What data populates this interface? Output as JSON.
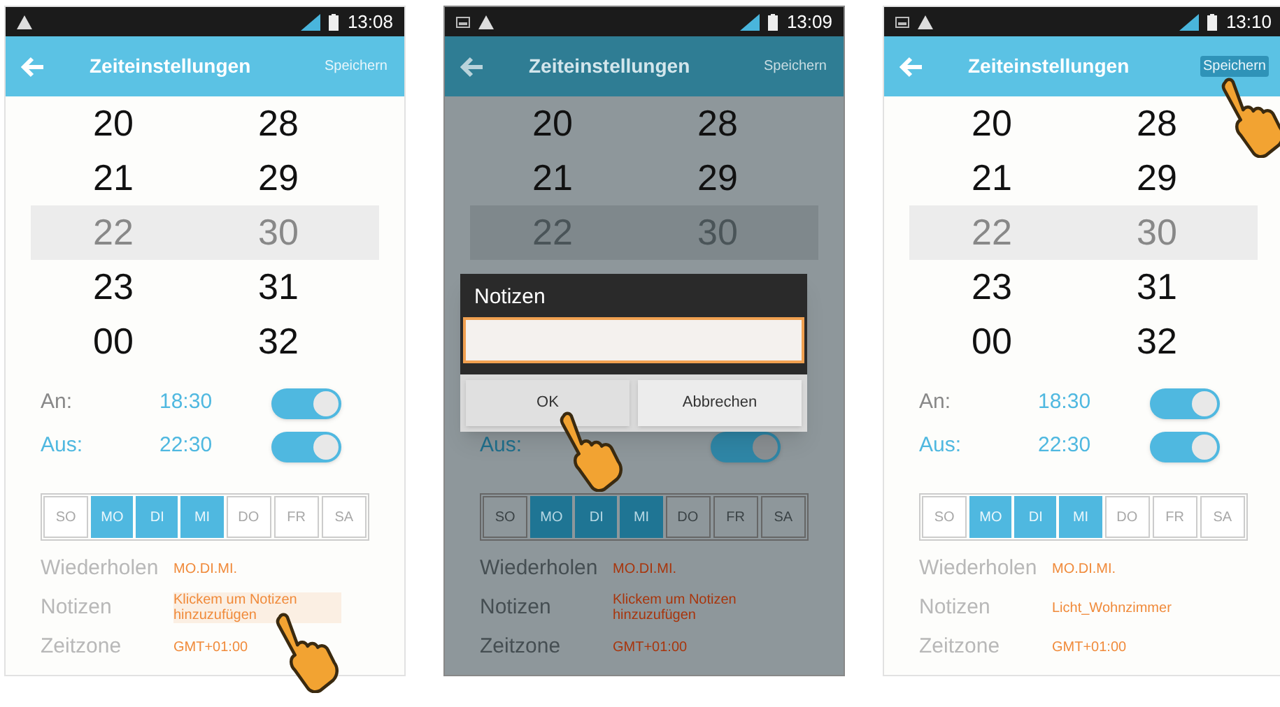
{
  "screens": [
    {
      "status_bar": {
        "time": "13:08",
        "extra_notification": false
      },
      "header": {
        "title": "Zeiteinstellungen",
        "action": "Speichern",
        "tapped": false
      },
      "dimmed": false,
      "picker": [
        {
          "hour": "20",
          "minute": "28",
          "selected": false
        },
        {
          "hour": "21",
          "minute": "29",
          "selected": false
        },
        {
          "hour": "22",
          "minute": "30",
          "selected": true
        },
        {
          "hour": "23",
          "minute": "31",
          "selected": false
        },
        {
          "hour": "00",
          "minute": "32",
          "selected": false
        }
      ],
      "on_row": {
        "label": "An:",
        "time": "18:30",
        "on": true
      },
      "off_row": {
        "label": "Aus:",
        "time": "22:30",
        "on": true
      },
      "days": [
        {
          "label": "SO",
          "selected": false
        },
        {
          "label": "MO",
          "selected": true
        },
        {
          "label": "DI",
          "selected": true
        },
        {
          "label": "MI",
          "selected": true
        },
        {
          "label": "DO",
          "selected": false
        },
        {
          "label": "FR",
          "selected": false
        },
        {
          "label": "SA",
          "selected": false
        }
      ],
      "details": [
        {
          "label": "Wiederholen",
          "value": "MO.DI.MI.",
          "tapped": false
        },
        {
          "label": "Notizen",
          "value": "Klickem um Notizen hinzuzufügen",
          "tapped": true
        },
        {
          "label": "Zeitzone",
          "value": "GMT+01:00",
          "tapped": false
        }
      ]
    },
    {
      "status_bar": {
        "time": "13:09",
        "extra_notification": true
      },
      "header": {
        "title": "Zeiteinstellungen",
        "action": "Speichern",
        "tapped": false
      },
      "dimmed": true,
      "picker": [
        {
          "hour": "20",
          "minute": "28",
          "selected": false
        },
        {
          "hour": "21",
          "minute": "29",
          "selected": false
        },
        {
          "hour": "22",
          "minute": "30",
          "selected": true
        }
      ],
      "off_row": {
        "label": "Aus:",
        "on": true
      },
      "days": [
        {
          "label": "SO",
          "selected": false
        },
        {
          "label": "MO",
          "selected": true
        },
        {
          "label": "DI",
          "selected": true
        },
        {
          "label": "MI",
          "selected": true
        },
        {
          "label": "DO",
          "selected": false
        },
        {
          "label": "FR",
          "selected": false
        },
        {
          "label": "SA",
          "selected": false
        }
      ],
      "details": [
        {
          "label": "Wiederholen",
          "value": "MO.DI.MI.",
          "tapped": false
        },
        {
          "label": "Notizen",
          "value": "Klickem um Notizen hinzuzufügen",
          "tapped": false
        },
        {
          "label": "Zeitzone",
          "value": "GMT+01:00",
          "tapped": false
        }
      ],
      "dialog": {
        "title": "Notizen",
        "buttons": [
          {
            "label": "OK",
            "tapped": true
          },
          {
            "label": "Abbrechen",
            "tapped": false
          }
        ]
      }
    },
    {
      "status_bar": {
        "time": "13:10",
        "extra_notification": true
      },
      "header": {
        "title": "Zeiteinstellungen",
        "action": "Speichern",
        "tapped": true
      },
      "dimmed": false,
      "picker": [
        {
          "hour": "20",
          "minute": "28",
          "selected": false
        },
        {
          "hour": "21",
          "minute": "29",
          "selected": false
        },
        {
          "hour": "22",
          "minute": "30",
          "selected": true
        },
        {
          "hour": "23",
          "minute": "31",
          "selected": false
        },
        {
          "hour": "00",
          "minute": "32",
          "selected": false
        }
      ],
      "on_row": {
        "label": "An:",
        "time": "18:30",
        "on": true
      },
      "off_row": {
        "label": "Aus:",
        "time": "22:30",
        "on": true
      },
      "days": [
        {
          "label": "SO",
          "selected": false
        },
        {
          "label": "MO",
          "selected": true
        },
        {
          "label": "DI",
          "selected": true
        },
        {
          "label": "MI",
          "selected": true
        },
        {
          "label": "DO",
          "selected": false
        },
        {
          "label": "FR",
          "selected": false
        },
        {
          "label": "SA",
          "selected": false
        }
      ],
      "details": [
        {
          "label": "Wiederholen",
          "value": "MO.DI.MI.",
          "tapped": false
        },
        {
          "label": "Notizen",
          "value": "Licht_Wohnzimmer",
          "tapped": false
        },
        {
          "label": "Zeitzone",
          "value": "GMT+01:00",
          "tapped": false
        }
      ]
    }
  ]
}
